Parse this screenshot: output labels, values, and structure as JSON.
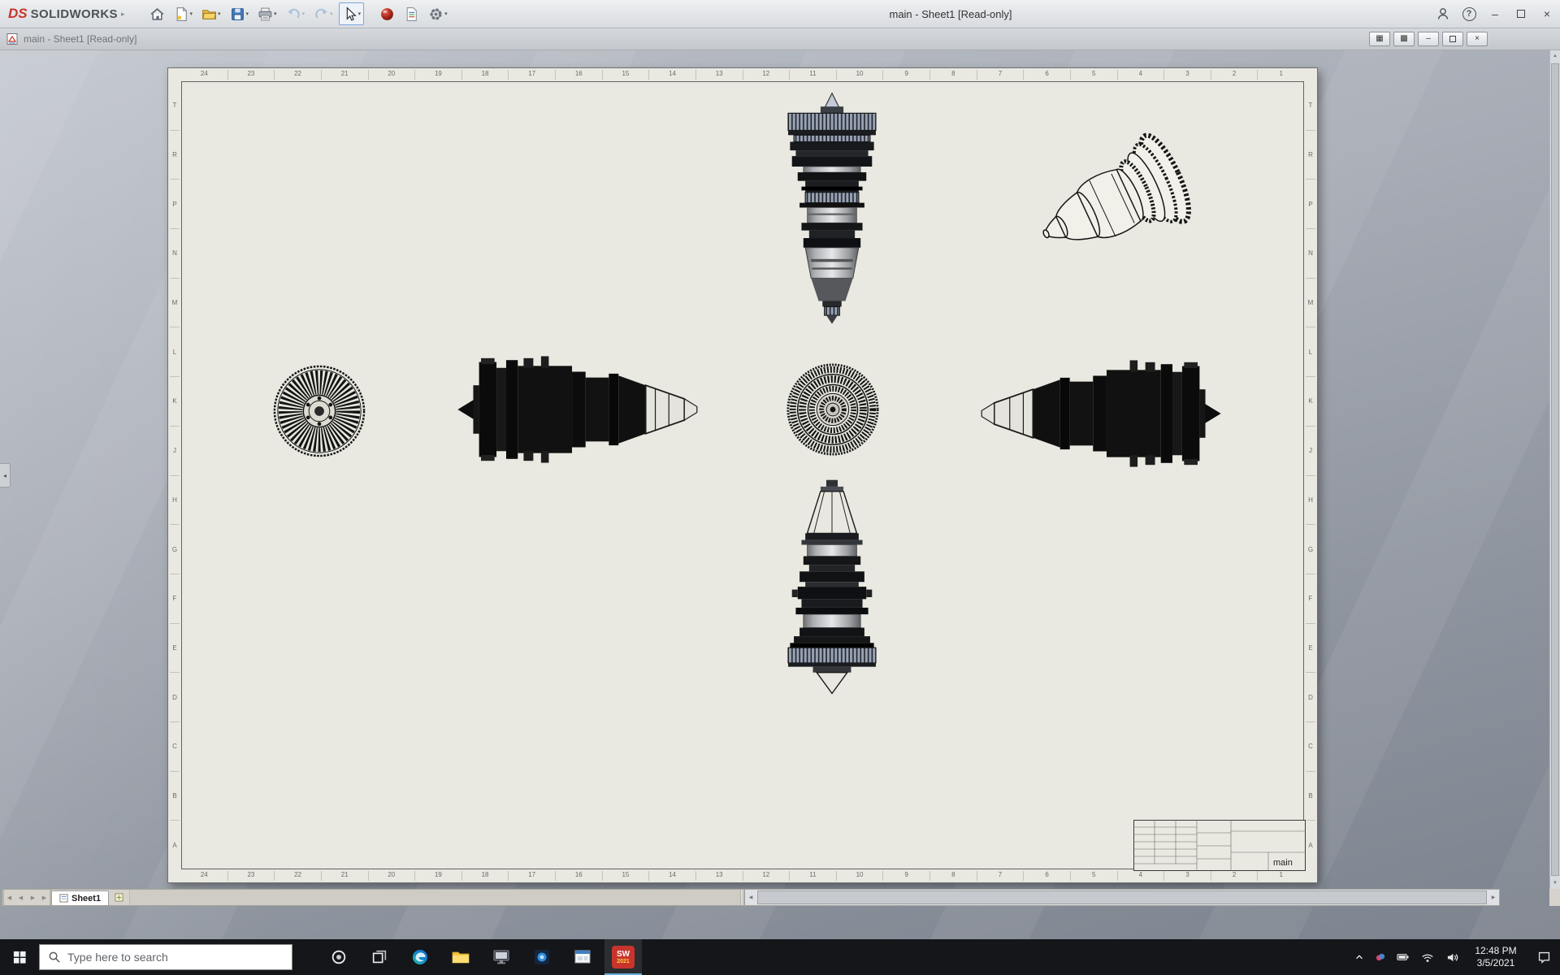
{
  "app": {
    "brand_ds": "DS",
    "brand_name": "SOLIDWORKS",
    "window_title": "main - Sheet1 [Read-only]"
  },
  "docbar": {
    "title": "main - Sheet1 [Read-only]"
  },
  "drawing": {
    "titleblock_name": "main",
    "sheet_tab": "Sheet1",
    "ruler_top": [
      "24",
      "23",
      "22",
      "21",
      "20",
      "19",
      "18",
      "17",
      "16",
      "15",
      "14",
      "13",
      "12",
      "11",
      "10",
      "9",
      "8",
      "7",
      "6",
      "5",
      "4",
      "3",
      "2",
      "1"
    ],
    "ruler_bottom": [
      "24",
      "23",
      "22",
      "21",
      "20",
      "19",
      "18",
      "17",
      "16",
      "15",
      "14",
      "13",
      "12",
      "11",
      "10",
      "9",
      "8",
      "7",
      "6",
      "5",
      "4",
      "3",
      "2",
      "1"
    ],
    "ruler_left": [
      "T",
      "R",
      "P",
      "N",
      "M",
      "L",
      "K",
      "J",
      "H",
      "G",
      "F",
      "E",
      "D",
      "C",
      "B",
      "A"
    ],
    "ruler_right": [
      "T",
      "R",
      "P",
      "N",
      "M",
      "L",
      "K",
      "J",
      "H",
      "G",
      "F",
      "E",
      "D",
      "C",
      "B",
      "A"
    ]
  },
  "taskbar": {
    "search_placeholder": "Type here to search",
    "clock_time": "12:48 PM",
    "clock_date": "3/5/2021",
    "sw_icon_text": "SW",
    "sw_icon_year": "2021"
  },
  "icons": {
    "dropdown_caret": "▾",
    "brand_arrow": "▸",
    "help_glyph": "?",
    "minimize_glyph": "–",
    "close_glyph": "×",
    "tile_glyph": "▦",
    "cascade_glyph": "▩",
    "left_arrow": "◀",
    "right_arrow": "▶",
    "up_arrow": "▲",
    "down_arrow": "▼",
    "flyout_left": "◂"
  },
  "colors": {
    "accent_red": "#c8342c",
    "sheet": "#e9e9e1",
    "taskbar_bg": "#14161a"
  }
}
